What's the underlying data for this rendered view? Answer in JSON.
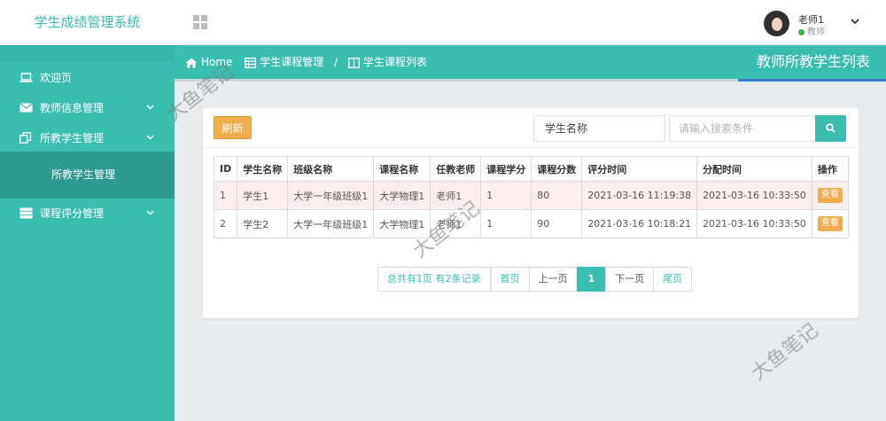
{
  "brand": {
    "title": "学生成绩管理系统"
  },
  "user": {
    "name": "老师1",
    "role": "教师"
  },
  "sidebar": {
    "items": [
      {
        "label": "欢迎页",
        "icon": "laptop-icon",
        "has_children": false
      },
      {
        "label": "教师信息管理",
        "icon": "envelope-icon",
        "has_children": true
      },
      {
        "label": "所教学生管理",
        "icon": "copy-icon",
        "has_children": true
      },
      {
        "label": "课程评分管理",
        "icon": "server-icon",
        "has_children": true
      }
    ],
    "active_sub": "所教学生管理"
  },
  "breadcrumb": {
    "home": "Home",
    "items": [
      "学生课程管理",
      "学生课程列表"
    ],
    "separator": "/"
  },
  "page_title": "教师所教学生列表",
  "toolbar": {
    "refresh_label": "刷新",
    "search_field": "学生名称",
    "search_placeholder": "请输入搜索条件"
  },
  "table": {
    "headers": [
      "ID",
      "学生名称",
      "班级名称",
      "课程名称",
      "任教老师",
      "课程学分",
      "课程分数",
      "评分时间",
      "分配时间",
      "操作"
    ],
    "rows": [
      [
        "1",
        "学生1",
        "大学一年级班级1",
        "大学物理1",
        "老师1",
        "1",
        "80",
        "2021-03-16 11:19:38",
        "2021-03-16 10:33:50",
        "查看"
      ],
      [
        "2",
        "学生2",
        "大学一年级班级1",
        "大学物理1",
        "老师1",
        "1",
        "90",
        "2021-03-16 10:18:21",
        "2021-03-16 10:33:50",
        "查看"
      ]
    ]
  },
  "pagination": {
    "info": "总共有1页  有2条记录",
    "first": "首页",
    "prev": "上一页",
    "current": "1",
    "next": "下一页",
    "last": "尾页"
  },
  "watermark": "大鱼笔记",
  "colors": {
    "primary": "#3bbeb2",
    "primary_dark": "#2e9990",
    "warning": "#f0ad4e",
    "accent_line": "#3b7fd4"
  }
}
